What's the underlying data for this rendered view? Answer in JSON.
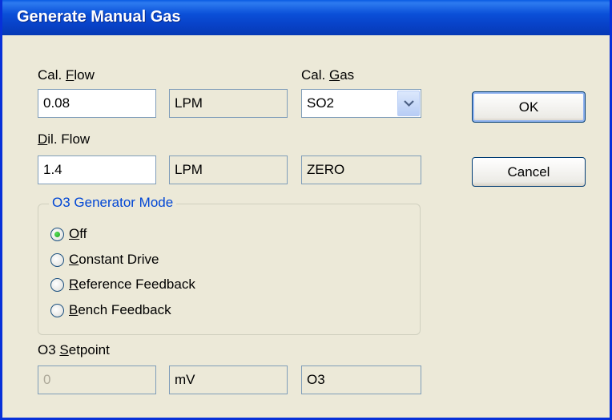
{
  "dialog": {
    "title": "Generate Manual Gas"
  },
  "cal_flow": {
    "label_pre": "Cal. ",
    "label_key": "F",
    "label_post": "low",
    "value": "0.08",
    "unit": "LPM"
  },
  "cal_gas": {
    "label_pre": "Cal. ",
    "label_key": "G",
    "label_post": "as",
    "selected": "SO2"
  },
  "dil_flow": {
    "label_key": "D",
    "label_post": "il. Flow",
    "value": "1.4",
    "unit": "LPM",
    "gas": "ZERO"
  },
  "o3_mode": {
    "legend": "O3 Generator Mode",
    "options": [
      {
        "key": "O",
        "rest": "ff",
        "selected": true
      },
      {
        "key": "C",
        "rest": "onstant Drive",
        "selected": false
      },
      {
        "key": "R",
        "rest": "eference Feedback",
        "selected": false
      },
      {
        "key": "B",
        "rest": "ench Feedback",
        "selected": false
      }
    ]
  },
  "o3_setpoint": {
    "label_pre": "O3 ",
    "label_key": "S",
    "label_post": "etpoint",
    "value": "0",
    "unit": "mV",
    "gas": "O3"
  },
  "buttons": {
    "ok": "OK",
    "cancel": "Cancel"
  }
}
